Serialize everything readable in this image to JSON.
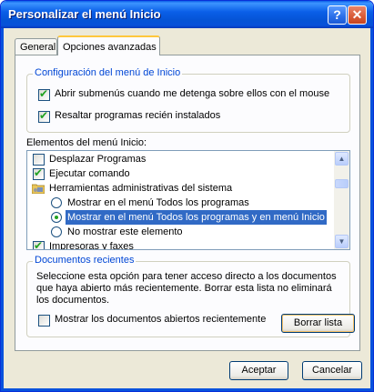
{
  "window": {
    "title": "Personalizar el menú Inicio",
    "help_glyph": "?",
    "close_glyph": "✕"
  },
  "tabs": [
    {
      "label": "General",
      "active": false
    },
    {
      "label": "Opciones avanzadas",
      "active": true
    }
  ],
  "config_group": {
    "legend": "Configuración del menú de Inicio",
    "options": [
      {
        "label": "Abrir submenús cuando me detenga sobre ellos con el mouse",
        "checked": true
      },
      {
        "label": "Resaltar programas recién instalados",
        "checked": true
      }
    ]
  },
  "elements_label": "Elementos del menú Inicio:",
  "elements_list": [
    {
      "kind": "checkbox",
      "label": "Desplazar Programas",
      "checked": false
    },
    {
      "kind": "checkbox",
      "label": "Ejecutar comando",
      "checked": true
    },
    {
      "kind": "folder",
      "label": "Herramientas administrativas del sistema",
      "icon": "admin-tools-icon"
    },
    {
      "kind": "radio",
      "label": "Mostrar en el menú Todos los programas",
      "selected": false
    },
    {
      "kind": "radio",
      "label": "Mostrar en el menú Todos los programas y en menú Inicio",
      "selected": true,
      "highlighted": true
    },
    {
      "kind": "radio",
      "label": "No mostrar este elemento",
      "selected": false
    },
    {
      "kind": "checkbox",
      "label": "Impresoras y faxes",
      "checked": true
    }
  ],
  "recent_group": {
    "legend": "Documentos recientes",
    "description": "Seleccione esta opción para tener acceso directo a los documentos que haya abierto más recientemente. Borrar esta lista no eliminará los documentos.",
    "show_recent_label": "Mostrar los documentos abiertos recientemente",
    "show_recent_checked": false,
    "clear_button": "Borrar lista"
  },
  "buttons": {
    "ok": "Aceptar",
    "cancel": "Cancelar"
  },
  "colors": {
    "titlebar": "#0a5fe8",
    "group_legend": "#0046d5",
    "selection": "#316ac5",
    "checkmark": "#21a121"
  }
}
